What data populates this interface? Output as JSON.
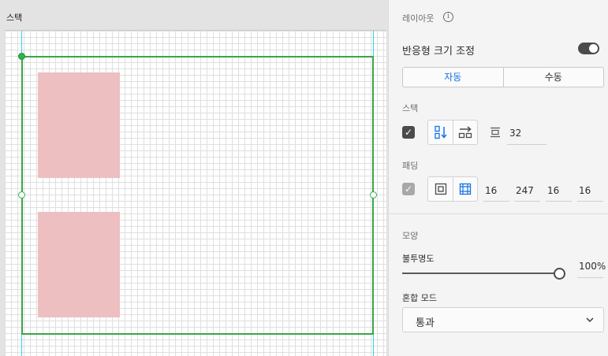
{
  "canvas": {
    "artboard_title": "스택"
  },
  "panel": {
    "layout": {
      "label": "레이아웃",
      "info_icon": "i"
    },
    "responsive_resize": {
      "label": "반응형 크기 조정",
      "toggle_on": true
    },
    "mode_tabs": [
      {
        "label": "자동",
        "active": true
      },
      {
        "label": "수동",
        "active": false
      }
    ],
    "stack": {
      "label": "스택",
      "checked": true,
      "spacing_value": "32"
    },
    "padding": {
      "label": "패딩",
      "values": [
        "16",
        "247",
        "16",
        "16"
      ]
    },
    "appearance": {
      "label": "모양",
      "opacity_label": "불투명도",
      "opacity_value": "100%",
      "opacity_fraction": 1.0,
      "blend_mode_label": "혼합 모드",
      "blend_mode_value": "통과"
    }
  },
  "colors": {
    "accent": "#1473e6",
    "stack_frame": "#3aa646",
    "guide": "#2ad8e6",
    "rect_fill": "#edbfc1"
  }
}
